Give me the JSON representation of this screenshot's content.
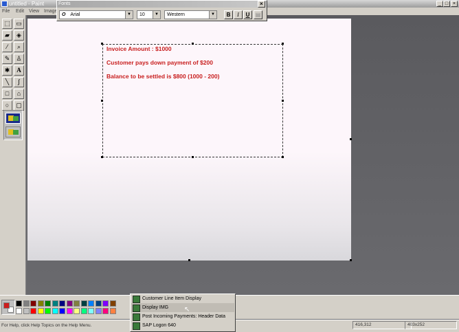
{
  "window": {
    "title": "untitled - Paint",
    "minimize": "_",
    "maximize": "□",
    "close": "×"
  },
  "menu": [
    "File",
    "Edit",
    "View",
    "Image"
  ],
  "fonts_toolbar": {
    "title": "Fonts",
    "close": "×",
    "font_name": "Arial",
    "font_icon": "O",
    "font_size": "10",
    "script": "Western",
    "bold": "B",
    "italic": "I",
    "underline": "U"
  },
  "canvas_text": {
    "line1": "Invoice Amount : $1000",
    "line2": "Customer pays down payment of $200",
    "line3": "Balance to be settled is $800  (1000 - 200)"
  },
  "tools": [
    {
      "icon": "free-select-icon",
      "glyph": "⬚"
    },
    {
      "icon": "rect-select-icon",
      "glyph": "▭"
    },
    {
      "icon": "eraser-icon",
      "glyph": "▰"
    },
    {
      "icon": "fill-icon",
      "glyph": "◈"
    },
    {
      "icon": "color-picker-icon",
      "glyph": "⁄"
    },
    {
      "icon": "magnifier-icon",
      "glyph": "⌕"
    },
    {
      "icon": "pencil-icon",
      "glyph": "✎"
    },
    {
      "icon": "brush-icon",
      "glyph": "♙"
    },
    {
      "icon": "airbrush-icon",
      "glyph": "✱"
    },
    {
      "icon": "text-icon",
      "glyph": "A"
    },
    {
      "icon": "line-icon",
      "glyph": "╲"
    },
    {
      "icon": "curve-icon",
      "glyph": "∫"
    },
    {
      "icon": "rectangle-icon",
      "glyph": "□"
    },
    {
      "icon": "polygon-icon",
      "glyph": "⌂"
    },
    {
      "icon": "ellipse-icon",
      "glyph": "○"
    },
    {
      "icon": "rounded-rect-icon",
      "glyph": "▢"
    }
  ],
  "palette": {
    "foreground": "#cc1e1e",
    "background": "#ffffff",
    "row1": [
      "#000000",
      "#808080",
      "#800000",
      "#808000",
      "#008000",
      "#008080",
      "#000080",
      "#800080",
      "#808040",
      "#004040",
      "#0080ff",
      "#004080",
      "#8000ff",
      "#804000"
    ],
    "row2": [
      "#ffffff",
      "#c0c0c0",
      "#ff0000",
      "#ffff00",
      "#00ff00",
      "#00ffff",
      "#0000ff",
      "#ff00ff",
      "#ffff80",
      "#00ff80",
      "#80ffff",
      "#8080ff",
      "#ff0080",
      "#ff8040"
    ]
  },
  "status": {
    "help": "For Help, click Help Topics on the Help Menu.",
    "coords": "416,312",
    "size": "403x252"
  },
  "taskbar_popup": [
    "Customer Line Item Display",
    "Display IMG",
    "Post Incoming Payments: Header Data",
    "SAP Logon 640"
  ]
}
